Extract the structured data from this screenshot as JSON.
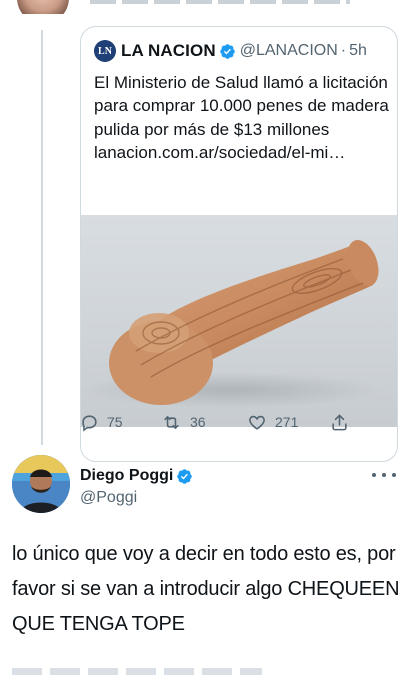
{
  "quoted_tweet": {
    "logo_text": "LN",
    "name": "LA NACION",
    "handle": "@LANACION",
    "separator": "·",
    "time": "5h",
    "text": "El Ministerio de Salud llamó a licitación para comprar 10.000 penes de madera pulida por más de $13 millones lanacion.com.ar/sociedad/el-mi…",
    "image_alt": "wooden-object-photo",
    "stats": {
      "replies": "75",
      "retweets": "36",
      "likes": "271"
    }
  },
  "tweet": {
    "author_name": "Diego Poggi",
    "author_handle": "@Poggi",
    "body": "lo único que voy a decir en todo esto es, por favor si se van a introducir algo CHEQUEEN QUE TENGA TOPE"
  },
  "colors": {
    "text_primary": "#0f1419",
    "text_secondary": "#536471",
    "verified_blue": "#1d9bf0",
    "border": "#cfd9de"
  },
  "icons": {
    "reply": "reply-icon",
    "retweet": "retweet-icon",
    "like": "heart-icon",
    "share": "share-icon",
    "verified": "verified-badge-icon",
    "more": "more-dots-icon"
  }
}
